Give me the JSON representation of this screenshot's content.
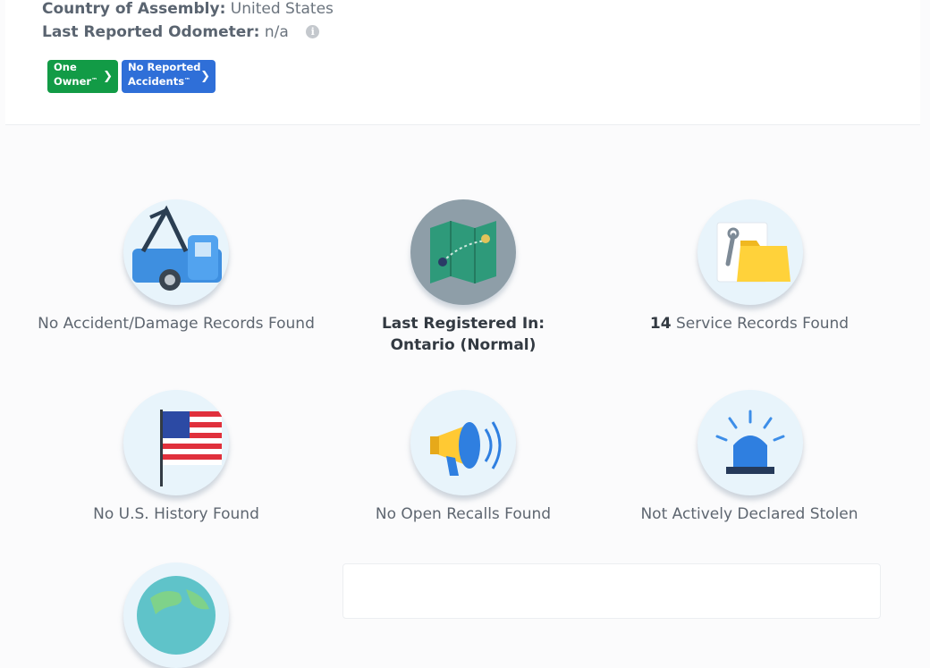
{
  "vehicle": {
    "assembly_label": "Country of Assembly:",
    "assembly_value": "United States",
    "odometer_label": "Last Reported Odometer:",
    "odometer_value": "n/a",
    "info_icon": "info-icon"
  },
  "badges": {
    "one_owner_line1": "One",
    "one_owner_line2": "Owner",
    "no_accidents_line1": "No Reported",
    "no_accidents_line2": "Accidents",
    "trademark": "™",
    "chevron_icon": "chevron-right-icon",
    "one_owner_color": "#129b46",
    "no_accidents_color": "#2f6fd8"
  },
  "tiles": {
    "accident": {
      "icon": "tow-truck-icon",
      "text": "No Accident/Damage Records Found"
    },
    "registration": {
      "icon": "map-icon",
      "prefix": "Last Registered In:",
      "value": "Ontario (Normal)"
    },
    "service": {
      "icon": "service-folder-icon",
      "count": "14",
      "text": "Service Records Found"
    },
    "us_history": {
      "icon": "us-flag-icon",
      "text": "No U.S. History Found"
    },
    "recalls": {
      "icon": "megaphone-icon",
      "text": "No Open Recalls Found"
    },
    "stolen": {
      "icon": "siren-icon",
      "text": "Not Actively Declared Stolen"
    },
    "global": {
      "icon": "globe-icon"
    }
  }
}
